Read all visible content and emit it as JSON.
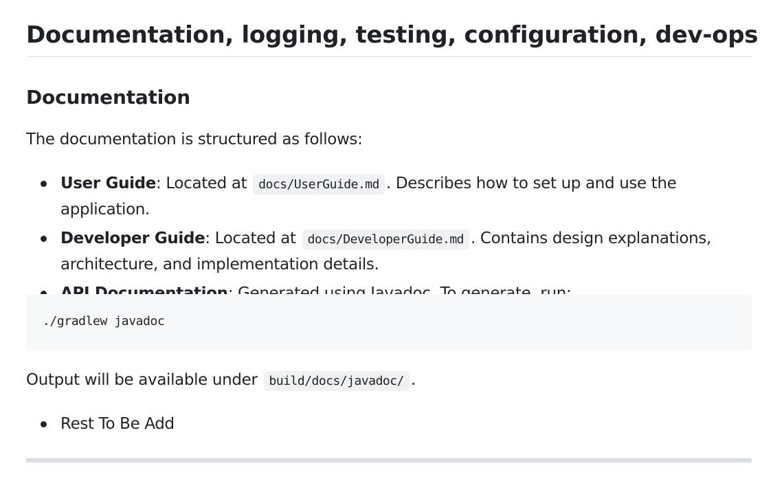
{
  "heading": "Documentation, logging, testing, configuration, dev-ops",
  "section": {
    "title": "Documentation",
    "intro": "The documentation is structured as follows:",
    "items": [
      {
        "label": "User Guide",
        "text_before": ": Located at ",
        "code": "docs/UserGuide.md",
        "text_after": ". Describes how to set up and use the application."
      },
      {
        "label": "Developer Guide",
        "text_before": ": Located at ",
        "code": "docs/DeveloperGuide.md",
        "text_after": ". Contains design explanations, architecture, and implementation details."
      },
      {
        "label": "API Documentation",
        "text_before": ": Generated using Javadoc. To generate, run:"
      }
    ],
    "code_block": "./gradlew javadoc",
    "output_before": "Output will be available under ",
    "output_code": "build/docs/javadoc/",
    "output_after": ".",
    "rest_items": [
      "Rest To Be Add"
    ]
  }
}
